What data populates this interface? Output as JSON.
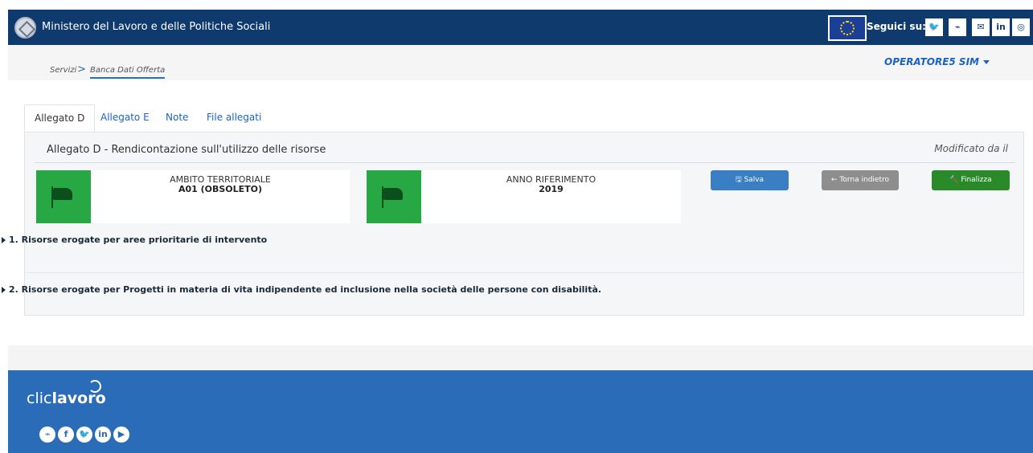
{
  "header": {
    "ministry": "Ministero del Lavoro e delle Politiche Sociali",
    "follow_label": "Seguici su:",
    "social": [
      {
        "icon": "twitter-icon",
        "glyph": "🐦"
      },
      {
        "icon": "rss-icon",
        "glyph": "⌁"
      },
      {
        "icon": "mail-icon",
        "glyph": "✉"
      },
      {
        "icon": "linkedin-icon",
        "glyph": "in"
      },
      {
        "icon": "instagram-icon",
        "glyph": "◎"
      }
    ]
  },
  "breadcrumb": {
    "items": [
      "Servizi",
      "Banca Dati Offerta"
    ],
    "separator": ">"
  },
  "user": {
    "name": "OPERATORE5 SIM"
  },
  "tabs": [
    "Allegato D",
    "Allegato E",
    "Note",
    "File allegati"
  ],
  "panel": {
    "title": "Allegato D - Rendicontazione sull'utilizzo delle risorse",
    "modified": "Modificato da il",
    "cards": [
      {
        "label": "AMBITO TERRITORIALE",
        "value": "A01 (OBSOLETO)"
      },
      {
        "label": "ANNO RIFERIMENTO",
        "value": "2019"
      }
    ],
    "buttons": {
      "save": "🖫 Salva",
      "back": "← Torna indietro",
      "finalize": "🔨 Finalizza"
    },
    "sections": [
      "1. Risorse erogate per aree prioritarie di intervento",
      "2. Risorse erogate per Progetti in materia di vita indipendente ed inclusione nella società delle persone con disabilità."
    ]
  },
  "footer": {
    "brand_light": "clic",
    "brand_bold": "lavoro",
    "social": [
      {
        "icon": "rss-icon",
        "glyph": "⌁"
      },
      {
        "icon": "facebook-icon",
        "glyph": "f"
      },
      {
        "icon": "twitter-icon",
        "glyph": "🐦"
      },
      {
        "icon": "linkedin-icon",
        "glyph": "in"
      },
      {
        "icon": "youtube-icon",
        "glyph": "▶"
      }
    ]
  },
  "colors": {
    "header_bg": "#0f3a6e",
    "link": "#1a63c4",
    "card_flag": "#28a745",
    "btn_save": "#3a7fc4",
    "btn_back": "#8e8e8e",
    "btn_finalize": "#2a8a2a",
    "footer_bg": "#2b6cb8"
  }
}
